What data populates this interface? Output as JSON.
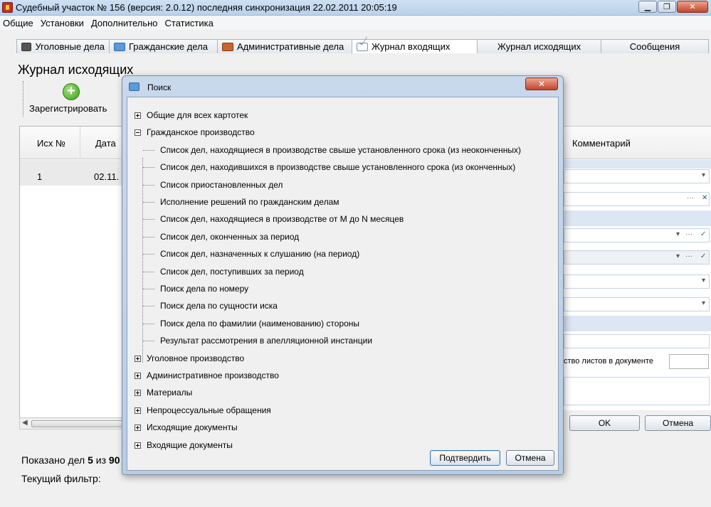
{
  "window": {
    "title": "Судебный участок № 156 (версия: 2.0.12) последняя синхронизация 22.02.2011 20:05:19",
    "minimize": "▁",
    "maximize": "❐",
    "close": "✕"
  },
  "menu": [
    "Общие",
    "Установки",
    "Дополнительно",
    "Статистика"
  ],
  "tabs": [
    {
      "label": "Уголовные дела",
      "icon": "briefcase-icon"
    },
    {
      "label": "Гражданские дела",
      "icon": "civil-case-icon"
    },
    {
      "label": "Административные дела",
      "icon": "admin-case-icon"
    },
    {
      "label": "Журнал входящих",
      "icon": "mail-icon",
      "active": true
    },
    {
      "label": "Журнал исходящих",
      "icon": ""
    },
    {
      "label": "Сообщения",
      "icon": ""
    }
  ],
  "page": {
    "title": "Журнал исходящих",
    "register_label": "Зарегистрировать",
    "register_icon_glyph": "+"
  },
  "grid": {
    "columns": [
      "Исх №",
      "Дата"
    ],
    "rows": [
      [
        "1",
        "02.11."
      ]
    ],
    "scroll_arrow": "◀"
  },
  "footer": {
    "shown_prefix": "Показано дел",
    "shown_count": "5",
    "shown_of": "из",
    "shown_total": "90",
    "filter_label": "Текущий фильтр:"
  },
  "right_panel": {
    "comment_header": "Комментарий",
    "sheets_label": "ство листов в документе",
    "ok": "OK",
    "cancel": "Отмена",
    "ellipsis": "···",
    "clear": "✕",
    "dropdown": "▾",
    "check": "✓"
  },
  "dialog": {
    "title": "Поиск",
    "close": "✕",
    "tree": [
      {
        "label": "Общие для всех картотек",
        "expander": "plus"
      },
      {
        "label": "Гражданское производство",
        "expander": "minus",
        "children": [
          "Список дел, находящиеся в производстве свыше установленного срока (из неоконченных)",
          "Список дел, находившихся в производстве свыше установленного срока (из оконченных)",
          "Список приостановленных дел",
          "Исполнение решений по гражданским делам",
          "Список дел, находящиеся в производстве от М до N месяцев",
          "Список дел, оконченных за период",
          "Список дел, назначенных к слушанию (на период)",
          "Список дел, поступивших за период",
          "Поиск дела по номеру",
          "Поиск дела по сущности иска",
          "Поиск дела по фамилии (наименованию) стороны",
          "Результат рассмотрения в апелляционной инстанции"
        ]
      },
      {
        "label": "Уголовное  производство",
        "expander": "plus"
      },
      {
        "label": "Административное производство",
        "expander": "plus"
      },
      {
        "label": "Материалы",
        "expander": "plus"
      },
      {
        "label": "Непроцессуальные обращения",
        "expander": "plus"
      },
      {
        "label": "Исходящие документы",
        "expander": "plus"
      },
      {
        "label": "Входящие документы",
        "expander": "plus"
      }
    ],
    "confirm": "Подтвердить",
    "cancel": "Отмена"
  }
}
